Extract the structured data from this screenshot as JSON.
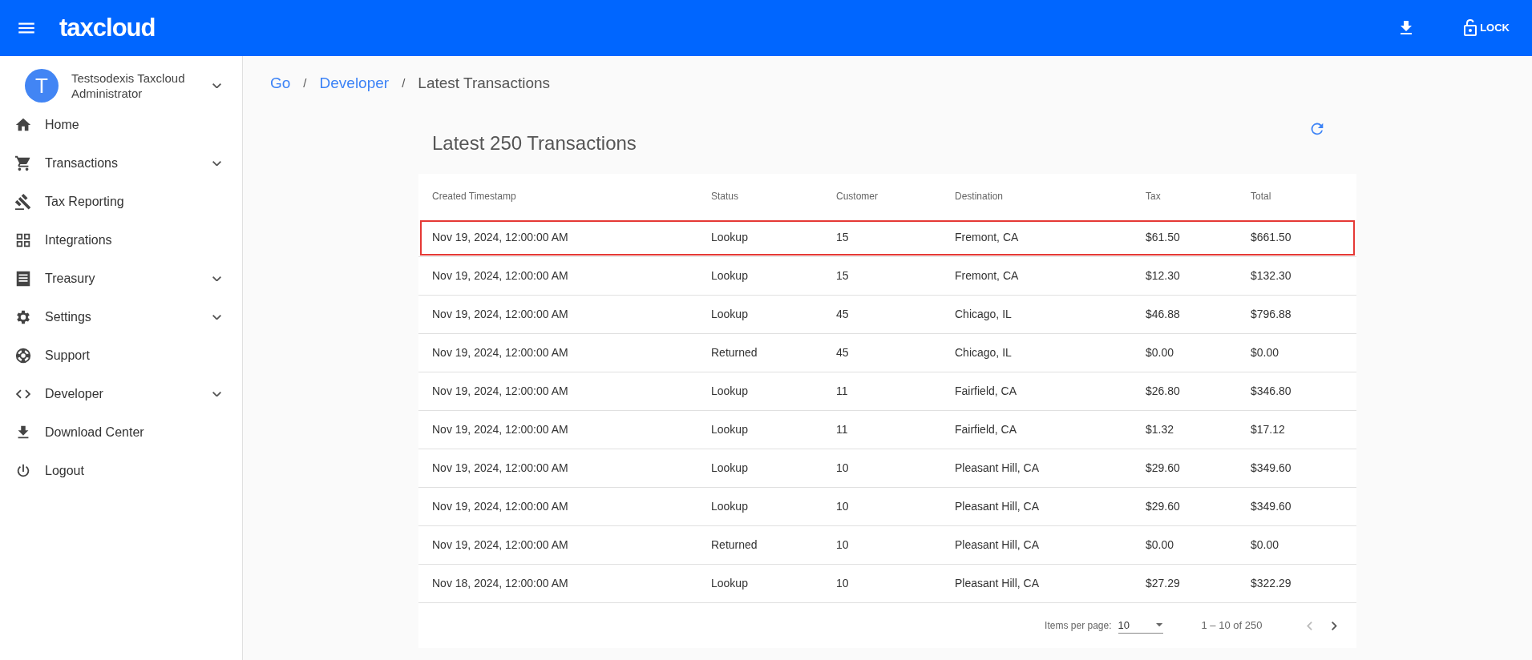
{
  "app_bar": {
    "logo": "taxcloud",
    "lock_label": "LOCK"
  },
  "user": {
    "avatar_letter": "T",
    "name": "Testsodexis Taxcloud Administrator",
    "expanded": false
  },
  "sidebar": {
    "items": [
      {
        "label": "Home",
        "has_submenu": false
      },
      {
        "label": "Transactions",
        "has_submenu": true
      },
      {
        "label": "Tax Reporting",
        "has_submenu": false
      },
      {
        "label": "Integrations",
        "has_submenu": false
      },
      {
        "label": "Treasury",
        "has_submenu": true
      },
      {
        "label": "Settings",
        "has_submenu": true
      },
      {
        "label": "Support",
        "has_submenu": false
      },
      {
        "label": "Developer",
        "has_submenu": true
      },
      {
        "label": "Download Center",
        "has_submenu": false
      },
      {
        "label": "Logout",
        "has_submenu": false
      }
    ]
  },
  "breadcrumb": [
    {
      "kind": "link",
      "label": "Go"
    },
    {
      "kind": "separator",
      "label": "/"
    },
    {
      "kind": "link",
      "label": "Developer"
    },
    {
      "kind": "separator",
      "label": "/"
    },
    {
      "kind": "current",
      "label": "Latest Transactions"
    }
  ],
  "panel": {
    "title": "Latest 250 Transactions"
  },
  "table": {
    "columns": [
      "Created Timestamp",
      "Status",
      "Customer",
      "Destination",
      "Tax",
      "Total"
    ],
    "rows": [
      {
        "cells": [
          "Nov 19, 2024, 12:00:00 AM",
          "Lookup",
          "15",
          "Fremont, CA",
          "$61.50",
          "$661.50"
        ],
        "highlighted": true
      },
      {
        "cells": [
          "Nov 19, 2024, 12:00:00 AM",
          "Lookup",
          "15",
          "Fremont, CA",
          "$12.30",
          "$132.30"
        ],
        "highlighted": false
      },
      {
        "cells": [
          "Nov 19, 2024, 12:00:00 AM",
          "Lookup",
          "45",
          "Chicago, IL",
          "$46.88",
          "$796.88"
        ],
        "highlighted": false
      },
      {
        "cells": [
          "Nov 19, 2024, 12:00:00 AM",
          "Returned",
          "45",
          "Chicago, IL",
          "$0.00",
          "$0.00"
        ],
        "highlighted": false
      },
      {
        "cells": [
          "Nov 19, 2024, 12:00:00 AM",
          "Lookup",
          "11",
          "Fairfield, CA",
          "$26.80",
          "$346.80"
        ],
        "highlighted": false
      },
      {
        "cells": [
          "Nov 19, 2024, 12:00:00 AM",
          "Lookup",
          "11",
          "Fairfield, CA",
          "$1.32",
          "$17.12"
        ],
        "highlighted": false
      },
      {
        "cells": [
          "Nov 19, 2024, 12:00:00 AM",
          "Lookup",
          "10",
          "Pleasant Hill, CA",
          "$29.60",
          "$349.60"
        ],
        "highlighted": false
      },
      {
        "cells": [
          "Nov 19, 2024, 12:00:00 AM",
          "Lookup",
          "10",
          "Pleasant Hill, CA",
          "$29.60",
          "$349.60"
        ],
        "highlighted": false
      },
      {
        "cells": [
          "Nov 19, 2024, 12:00:00 AM",
          "Returned",
          "10",
          "Pleasant Hill, CA",
          "$0.00",
          "$0.00"
        ],
        "highlighted": false
      },
      {
        "cells": [
          "Nov 18, 2024, 12:00:00 AM",
          "Lookup",
          "10",
          "Pleasant Hill, CA",
          "$27.29",
          "$322.29"
        ],
        "highlighted": false
      }
    ]
  },
  "paginator": {
    "items_per_page_label": "Items per page:",
    "page_size": "10",
    "range": "1 – 10 of 250",
    "previous_disabled": true,
    "next_disabled": false
  }
}
